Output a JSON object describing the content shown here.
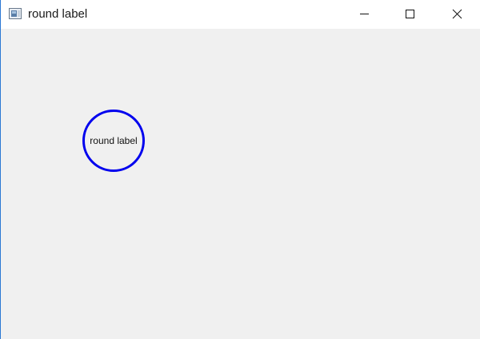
{
  "window": {
    "title": "round label",
    "icon": "app-window-icon",
    "controls": {
      "minimize_icon": "minimize-icon",
      "maximize_icon": "maximize-icon",
      "close_icon": "close-icon"
    }
  },
  "content": {
    "label_text": "round label",
    "label_border_color": "#0000ee",
    "background_color": "#f0f0f0"
  }
}
